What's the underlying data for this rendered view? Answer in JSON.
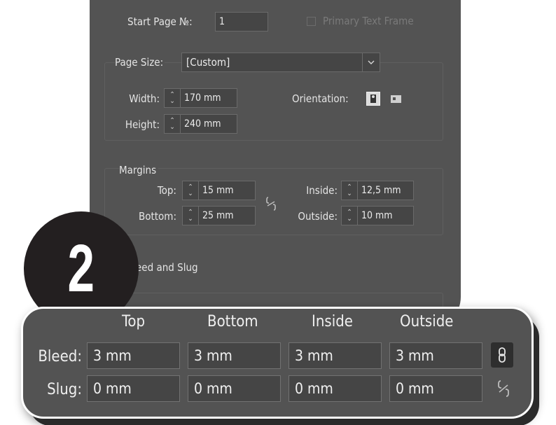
{
  "document_setup": {
    "start_page": {
      "label": "Start Page №:",
      "value": "1"
    },
    "primary_text_frame": {
      "label": "Primary Text Frame",
      "checked": false
    },
    "page_size": {
      "label": "Page Size:",
      "value": "[Custom]"
    },
    "width": {
      "label": "Width:",
      "value": "170 mm"
    },
    "height": {
      "label": "Height:",
      "value": "240 mm"
    },
    "orientation": {
      "label": "Orientation:",
      "selected": "portrait"
    },
    "margins": {
      "title": "Margins",
      "top": {
        "label": "Top:",
        "value": "15 mm"
      },
      "bottom": {
        "label": "Bottom:",
        "value": "25 mm"
      },
      "inside": {
        "label": "Inside:",
        "value": "12,5 mm"
      },
      "outside": {
        "label": "Outside:",
        "value": "10 mm"
      },
      "linked": false
    },
    "bleed_slug_title": "eed and Slug"
  },
  "step_badge": "2",
  "bleed_slug": {
    "headers": [
      "Top",
      "Bottom",
      "Inside",
      "Outside"
    ],
    "bleed": {
      "label": "Bleed:",
      "values": [
        "3 mm",
        "3 mm",
        "3 mm",
        "3 mm"
      ],
      "linked": true
    },
    "slug": {
      "label": "Slug:",
      "values": [
        "0 mm",
        "0 mm",
        "0 mm",
        "0 mm"
      ],
      "linked": false
    }
  },
  "colors": {
    "panel": "#535353",
    "field": "#454545",
    "badge": "#231f20"
  }
}
